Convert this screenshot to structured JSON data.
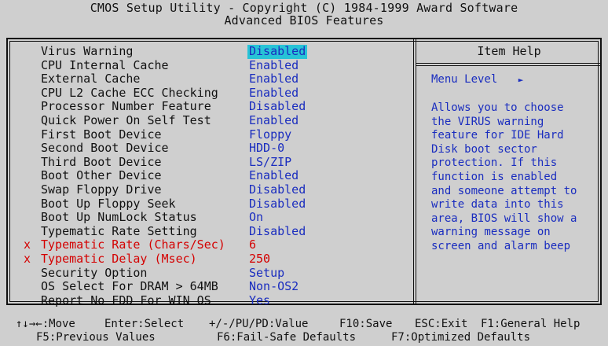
{
  "header": {
    "title": "CMOS Setup Utility - Copyright (C) 1984-1999 Award Software",
    "subtitle": "Advanced BIOS Features"
  },
  "settings": [
    {
      "label": "Virus Warning",
      "value": "Disabled",
      "selected": true,
      "disabled_item": false
    },
    {
      "label": "CPU Internal Cache",
      "value": "Enabled",
      "selected": false,
      "disabled_item": false
    },
    {
      "label": "External Cache",
      "value": "Enabled",
      "selected": false,
      "disabled_item": false
    },
    {
      "label": "CPU L2 Cache ECC Checking",
      "value": "Enabled",
      "selected": false,
      "disabled_item": false
    },
    {
      "label": "Processor Number Feature",
      "value": "Disabled",
      "selected": false,
      "disabled_item": false
    },
    {
      "label": "Quick Power On Self Test",
      "value": "Enabled",
      "selected": false,
      "disabled_item": false
    },
    {
      "label": "First Boot Device",
      "value": "Floppy",
      "selected": false,
      "disabled_item": false
    },
    {
      "label": "Second Boot Device",
      "value": "HDD-0",
      "selected": false,
      "disabled_item": false
    },
    {
      "label": "Third Boot Device",
      "value": "LS/ZIP",
      "selected": false,
      "disabled_item": false
    },
    {
      "label": "Boot Other Device",
      "value": "Enabled",
      "selected": false,
      "disabled_item": false
    },
    {
      "label": "Swap Floppy Drive",
      "value": "Disabled",
      "selected": false,
      "disabled_item": false
    },
    {
      "label": "Boot Up Floppy Seek",
      "value": "Disabled",
      "selected": false,
      "disabled_item": false
    },
    {
      "label": "Boot Up NumLock Status",
      "value": "On",
      "selected": false,
      "disabled_item": false
    },
    {
      "label": "Typematic Rate Setting",
      "value": "Disabled",
      "selected": false,
      "disabled_item": false
    },
    {
      "label": "Typematic Rate (Chars/Sec)",
      "value": "6",
      "selected": false,
      "disabled_item": true,
      "mark": "x"
    },
    {
      "label": "Typematic Delay (Msec)",
      "value": "250",
      "selected": false,
      "disabled_item": true,
      "mark": "x"
    },
    {
      "label": "Security Option",
      "value": "Setup",
      "selected": false,
      "disabled_item": false
    },
    {
      "label": "OS Select For DRAM > 64MB",
      "value": "Non-OS2",
      "selected": false,
      "disabled_item": false
    },
    {
      "label": "Report No FDD For WIN OS",
      "value": "Yes",
      "selected": false,
      "disabled_item": false
    }
  ],
  "help": {
    "title": "Item Help",
    "menu_level_label": "Menu Level",
    "menu_level_arrow": "►",
    "text_lines": [
      "Allows you to choose",
      "the VIRUS warning",
      "feature for IDE Hard",
      "Disk boot sector",
      "protection. If this",
      "function is enabled",
      "and someone attempt to",
      "write data into this",
      "area, BIOS will show a",
      "warning message on",
      "screen and alarm beep"
    ]
  },
  "footer": {
    "line1": [
      {
        "text": "↑↓→←:Move",
        "name": "move-hint"
      },
      {
        "text": "Enter:Select",
        "name": "select-hint"
      },
      {
        "text": "+/-/PU/PD:Value",
        "name": "value-hint"
      },
      {
        "text": "F10:Save",
        "name": "save-hint"
      },
      {
        "text": "ESC:Exit",
        "name": "exit-hint"
      },
      {
        "text": "F1:General Help",
        "name": "general-help-hint"
      }
    ],
    "line2": [
      {
        "text": "F5:Previous Values",
        "name": "previous-values-hint"
      },
      {
        "text": "F6:Fail-Safe Defaults",
        "name": "fail-safe-defaults-hint"
      },
      {
        "text": "F7:Optimized Defaults",
        "name": "optimized-defaults-hint"
      }
    ]
  },
  "colors": {
    "background": "#cfcfcf",
    "value_text": "#1a2dbf",
    "disabled_text": "#d40000",
    "highlight": "#27c3d6"
  }
}
